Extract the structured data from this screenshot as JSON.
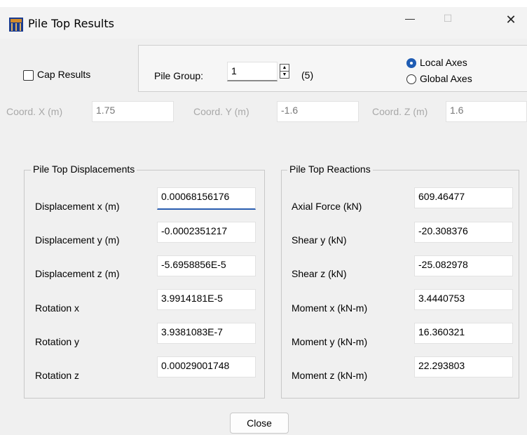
{
  "window": {
    "title": "Pile Top Results",
    "minimize_glyph": "—",
    "maximize_glyph": "☐",
    "close_glyph": "✕"
  },
  "cap_results": {
    "label": "Cap Results",
    "checked": false
  },
  "pile_group": {
    "label": "Pile Group:",
    "value": "1",
    "count": "(5)"
  },
  "axes": {
    "local_label": "Local Axes",
    "global_label": "Global Axes",
    "selected": "local"
  },
  "coords": {
    "x": {
      "label": "Coord. X  (m)",
      "value": "1.75"
    },
    "y": {
      "label": "Coord. Y  (m)",
      "value": "-1.6"
    },
    "z": {
      "label": "Coord. Z  (m)",
      "value": "1.6"
    }
  },
  "displacements": {
    "title": "Pile Top Displacements",
    "rows": [
      {
        "label": "Displacement x (m)",
        "value": "0.00068156176"
      },
      {
        "label": "Displacement y (m)",
        "value": "-0.0002351217"
      },
      {
        "label": "Displacement z (m)",
        "value": "-5.6958856E-5"
      },
      {
        "label": "Rotation x",
        "value": "3.9914181E-5"
      },
      {
        "label": "Rotation y",
        "value": "3.9381083E-7"
      },
      {
        "label": "Rotation z",
        "value": "0.00029001748"
      }
    ]
  },
  "reactions": {
    "title": "Pile Top Reactions",
    "rows": [
      {
        "label": "Axial Force (kN)",
        "value": "609.46477"
      },
      {
        "label": "Shear y (kN)",
        "value": "-20.308376"
      },
      {
        "label": "Shear z (kN)",
        "value": "-25.082978"
      },
      {
        "label": "Moment x (kN-m)",
        "value": "3.4440753"
      },
      {
        "label": "Moment y (kN-m)",
        "value": "16.360321"
      },
      {
        "label": "Moment z (kN-m)",
        "value": "22.293803"
      }
    ]
  },
  "close_button": {
    "label": "Close"
  },
  "colors": {
    "accent": "#1f5cb3",
    "window_bg": "#f0f0f0"
  }
}
